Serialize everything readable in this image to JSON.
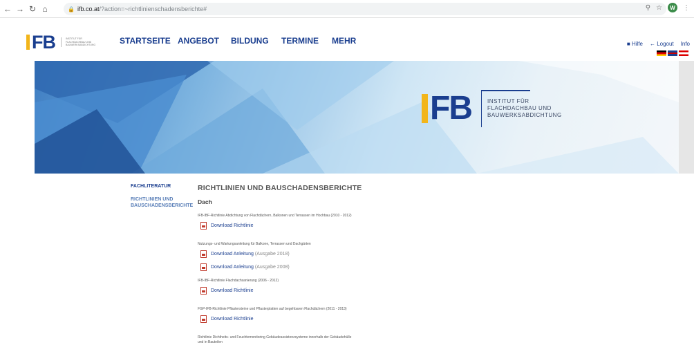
{
  "browser": {
    "url_host": "ifb.co.at",
    "url_path": "/?action=~richtlinienschadensberichte#",
    "avatar_letter": "W"
  },
  "header": {
    "logo_text": "FB",
    "logo_subtext": "INSTITUT FÜR FLACHDACHBAU UND BAUWERKSABDICHTUNG",
    "nav": [
      "STARTSEITE",
      "ANGEBOT",
      "BILDUNG",
      "TERMINE",
      "MEHR"
    ],
    "util": {
      "hilfe": "Hilfe",
      "logout": "Logout",
      "info": "Info"
    }
  },
  "hero": {
    "logo_text": "FB",
    "subtitle_line1": "INSTITUT FÜR",
    "subtitle_line2": "FLACHDACHBAU UND",
    "subtitle_line3": "BAUWERKSABDICHTUNG"
  },
  "sidebar": {
    "active": "FACHLITERATUR",
    "sub_line1": "RICHTLINIEN UND",
    "sub_line2": "BAUSCHADENSBERICHTE"
  },
  "main": {
    "heading": "RICHTLINIEN UND BAUSCHADENSBERICHTE",
    "section": "Dach",
    "entries": [
      {
        "title": "IFB-IBF-Richtlinie Abdichtung von Flachdächern, Balkonen und Terrassen im Hochbau (2010 - 2012)",
        "downloads": [
          {
            "label": "Download Richtlinie",
            "note": ""
          }
        ]
      },
      {
        "title": "Nutzungs- und Wartungsanleitung für Balkone, Terrassen und Dachgärten",
        "downloads": [
          {
            "label": "Download Anleitung",
            "note": "(Ausgabe 2018)"
          },
          {
            "label": "Download Anleitung",
            "note": "(Ausgabe 2008)"
          }
        ]
      },
      {
        "title": "IFB-IBF-Richtlinie Flachdachsanierung (2006 - 2012)",
        "downloads": [
          {
            "label": "Download Richtlinie",
            "note": ""
          }
        ]
      },
      {
        "title": "FGP-IFB-Richtlinie Pflastersteine und Pflasterplatten auf begehbaren Flachdächern (2011 - 2013)",
        "downloads": [
          {
            "label": "Download Richtlinie",
            "note": ""
          }
        ]
      },
      {
        "title_line1": "Richtlinie Dichtheits- und Feuchtemonitoring Gebäudeassistenzsysteme innerhalb der Gebäudehülle",
        "title_line2": "und in Bauteilen"
      }
    ]
  },
  "colors": {
    "brand_blue": "#1a3e8f",
    "brand_yellow": "#f2b51a",
    "pdf_red": "#c0392b"
  }
}
